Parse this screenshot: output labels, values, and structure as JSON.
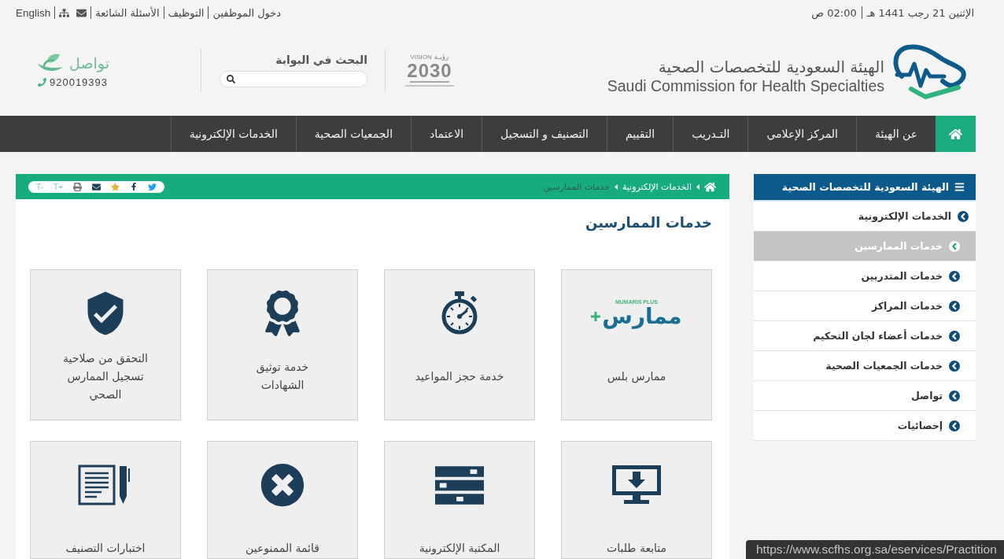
{
  "top_bar": {
    "date": "الإثنين 21 رجب 1441 هـ",
    "time": "02:00 ص",
    "links": [
      "دخول الموظفين",
      "التوظيف",
      "الأسئلة الشائعة"
    ],
    "language": "English"
  },
  "header": {
    "name_ar": "الهيئة السعودية للتخصصات الصحية",
    "name_en": "Saudi Commission for Health Specialties",
    "vision": {
      "label": "VISION",
      "label_ar": "رؤيـة",
      "year": "2030"
    },
    "search": {
      "label": "البحث في البوابة"
    },
    "contact": {
      "label": "تواصل",
      "phone": "920019393"
    }
  },
  "nav": {
    "items": [
      "عن الهيئة",
      "المركز الإعلامي",
      "التـدريب",
      "التقييم",
      "التصنيف و التسجيل",
      "الاعتماد",
      "الجمعيات الصحية",
      "الخدمات الإلكترونية"
    ]
  },
  "sidebar": {
    "title": "الهيئة السعودية للتخصصات الصحية",
    "items": [
      {
        "label": "الخدمات الإلكترونية",
        "selected": false,
        "children": [
          {
            "label": "خدمات الممارسين",
            "selected": true
          },
          {
            "label": "خدمات المتدربين",
            "selected": false
          },
          {
            "label": "خدمات المراكز",
            "selected": false
          },
          {
            "label": "خدمات أعضاء لجان التحكيم",
            "selected": false
          },
          {
            "label": "خدمات الجمعيات الصحية",
            "selected": false
          },
          {
            "label": "تواصل",
            "selected": false
          },
          {
            "label": "إحصائيات",
            "selected": false
          }
        ]
      }
    ]
  },
  "main": {
    "breadcrumb": [
      {
        "label": "الخدمات الإلكترونية",
        "current": false
      },
      {
        "label": "خدمات الممارسين",
        "current": true
      }
    ],
    "font_controls": [
      "T+",
      "T-"
    ],
    "title": "خدمات الممارسين",
    "tiles": [
      {
        "kind": "logo",
        "logo": {
          "caption": "MUMARIS PLUS",
          "word": "ممارس"
        },
        "lines": [
          "ممارس بلس"
        ]
      },
      {
        "kind": "stopwatch",
        "lines": [
          "خدمة حجز المواعيد"
        ]
      },
      {
        "kind": "award",
        "lines": [
          "خدمة توثيق",
          "الشهادات"
        ]
      },
      {
        "kind": "shield",
        "lines": [
          "التحقق من صلاحية",
          "تسجيل الممارس",
          "الصحي"
        ]
      },
      {
        "kind": "monitor",
        "lines": [
          "متابعة طلبات"
        ]
      },
      {
        "kind": "drawers",
        "lines": [
          "المكتبة الإلكترونية"
        ]
      },
      {
        "kind": "blocked",
        "lines": [
          "قائمة الممنوعين"
        ]
      },
      {
        "kind": "document",
        "lines": [
          "اختبارات التصنيف"
        ]
      }
    ]
  },
  "status_url": "https://www.scfhs.org.sa/eservices/Practition"
}
